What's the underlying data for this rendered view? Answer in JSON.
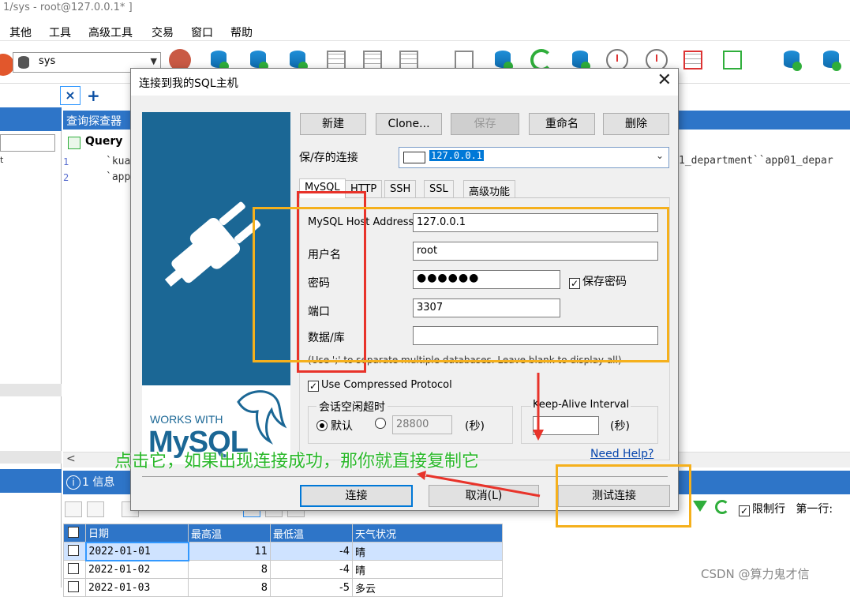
{
  "window": {
    "title": "1/sys - root@127.0.0.1* ]"
  },
  "menu": [
    "其他",
    "工具",
    "高级工具",
    "交易",
    "窗口",
    "帮助"
  ],
  "toolbar": {
    "db_selector": "sys"
  },
  "query_tab": {
    "close": "×",
    "add": "+"
  },
  "query_editor": {
    "header": "查询探查器",
    "tab_label": "Query",
    "lines": [
      {
        "num": "1",
        "text": "`kua"
      },
      {
        "num": "2",
        "text": "`app"
      }
    ],
    "right_text": "1_department``app01_depar"
  },
  "results": {
    "tab_label": "1 信息",
    "limit_rows_label": "限制行",
    "first_row_label": "第一行:",
    "columns": [
      "日期",
      "最高温",
      "最低温",
      "天气状况"
    ],
    "rows": [
      [
        "2022-01-01",
        "11",
        "-4",
        "晴"
      ],
      [
        "2022-01-02",
        "8",
        "-4",
        "晴"
      ],
      [
        "2022-01-03",
        "8",
        "-5",
        "多云"
      ]
    ]
  },
  "dialog": {
    "title": "连接到我的SQL主机",
    "close": "✕",
    "buttons": {
      "new": "新建",
      "clone": "Clone...",
      "save": "保存",
      "rename": "重命名",
      "delete": "删除"
    },
    "saved_label": "保/存的连接",
    "saved_value": "127.0.0.1",
    "tabs": [
      "MySQL",
      "HTTP",
      "SSH",
      "SSL",
      "高级功能"
    ],
    "fields": {
      "host_label": "MySQL Host Address",
      "host_value": "127.0.0.1",
      "user_label": "用户名",
      "user_value": "root",
      "password_label": "密码",
      "password_value": "●●●●●●",
      "save_password_label": "保存密码",
      "port_label": "端口",
      "port_value": "3307",
      "database_label": "数据/库",
      "database_value": ""
    },
    "hint": "(Use ';' to separate multiple databases. Leave blank to display all)",
    "compressed_label": "Use Compressed Protocol",
    "idle_timeout": {
      "title": "会话空闲超时",
      "default_label": "默认",
      "value": "28800",
      "unit": "(秒)"
    },
    "keepalive": {
      "title": "Keep-Alive Interval",
      "unit": "(秒)"
    },
    "need_help": "Need Help?",
    "footer": {
      "connect": "连接",
      "cancel": "取消(L)",
      "test": "测试连接"
    },
    "branding": {
      "works_with": "WORKS WITH",
      "logo": "MySQL"
    }
  },
  "annotation": {
    "text": "点击它，如果出现连接成功，那你就直接复制它"
  },
  "watermark": "CSDN @算力鬼才信",
  "colors": {
    "accent_blue": "#2e75c8",
    "brand_blue": "#1b6795",
    "annotation_red": "#e8332a",
    "annotation_orange": "#f5b01c",
    "annotation_green": "#2ab82a"
  }
}
